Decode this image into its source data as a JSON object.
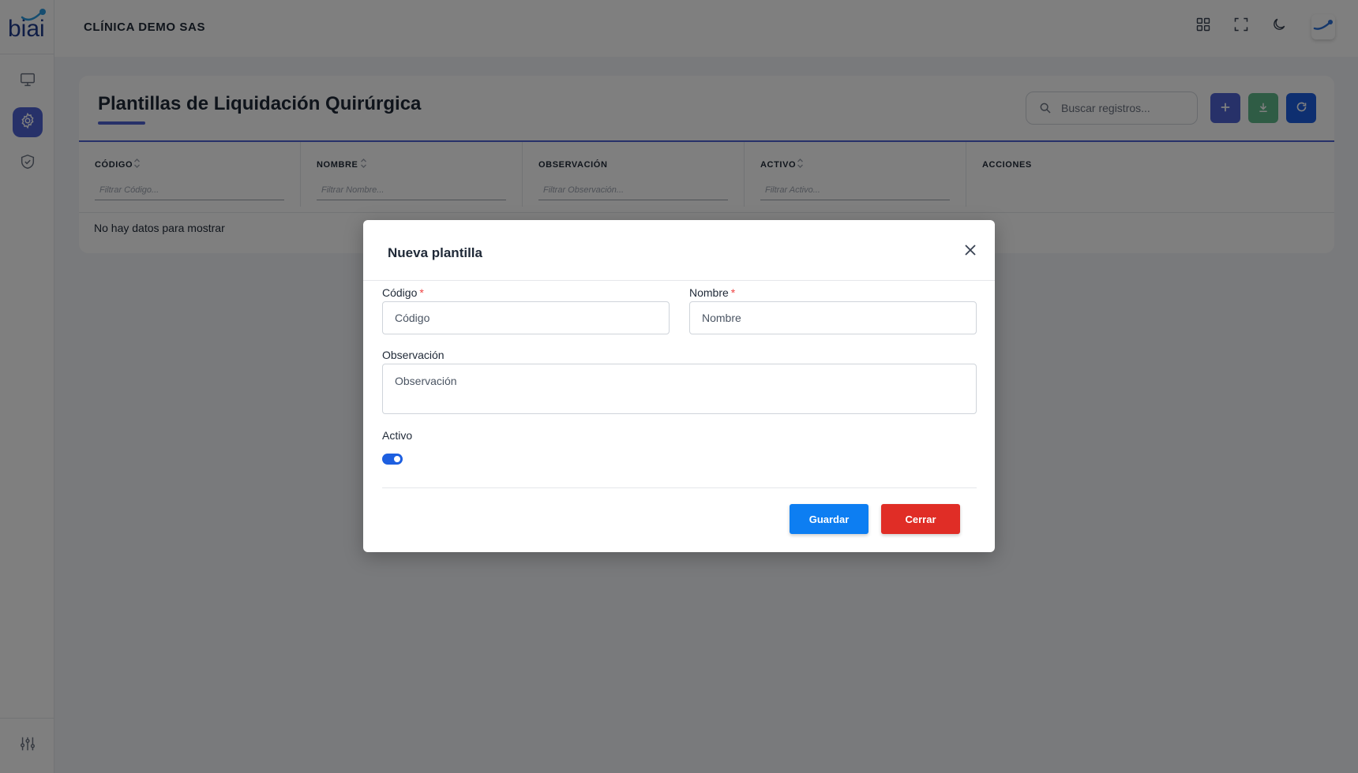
{
  "brand": {
    "logo_text": "biai"
  },
  "header": {
    "company": "CLÍNICA DEMO SAS",
    "icons": [
      "apps-grid-icon",
      "fullscreen-icon",
      "moon-icon",
      "avatar-icon"
    ]
  },
  "sidebar": {
    "items": [
      {
        "icon": "monitor-icon",
        "active": false
      },
      {
        "icon": "gear-icon",
        "active": true
      },
      {
        "icon": "shield-check-icon",
        "active": false
      }
    ],
    "bottom_icon": "sliders-icon"
  },
  "page": {
    "title": "Plantillas de Liquidación Quirúrgica",
    "search_placeholder": "Buscar registros...",
    "actions": [
      "add-icon",
      "download-icon",
      "refresh-icon"
    ]
  },
  "table": {
    "columns": [
      {
        "label": "CÓDIGO",
        "filter_placeholder": "Filtrar Código..."
      },
      {
        "label": "NOMBRE",
        "filter_placeholder": "Filtrar Nombre..."
      },
      {
        "label": "OBSERVACIÓN",
        "filter_placeholder": "Filtrar Observación..."
      },
      {
        "label": "ACTIVO",
        "filter_placeholder": "Filtrar Activo..."
      },
      {
        "label": "ACCIONES"
      }
    ],
    "empty_message": "No hay datos para mostrar"
  },
  "modal": {
    "title": "Nueva plantilla",
    "fields": {
      "codigo": {
        "label": "Código",
        "required_mark": "*",
        "placeholder": "Código",
        "value": ""
      },
      "nombre": {
        "label": "Nombre",
        "required_mark": "*",
        "placeholder": "Nombre",
        "value": ""
      },
      "observacion": {
        "label": "Observación",
        "placeholder": "Observación",
        "value": ""
      },
      "activo": {
        "label": "Activo",
        "checked": true
      }
    },
    "buttons": {
      "save": "Guardar",
      "close": "Cerrar"
    }
  },
  "colors": {
    "primary": "#4f63d2",
    "save": "#0d7ef2",
    "close": "#e02d26",
    "export": "#5fb98a",
    "refresh": "#1d5fe0",
    "toggle": "#1d5fe0"
  }
}
